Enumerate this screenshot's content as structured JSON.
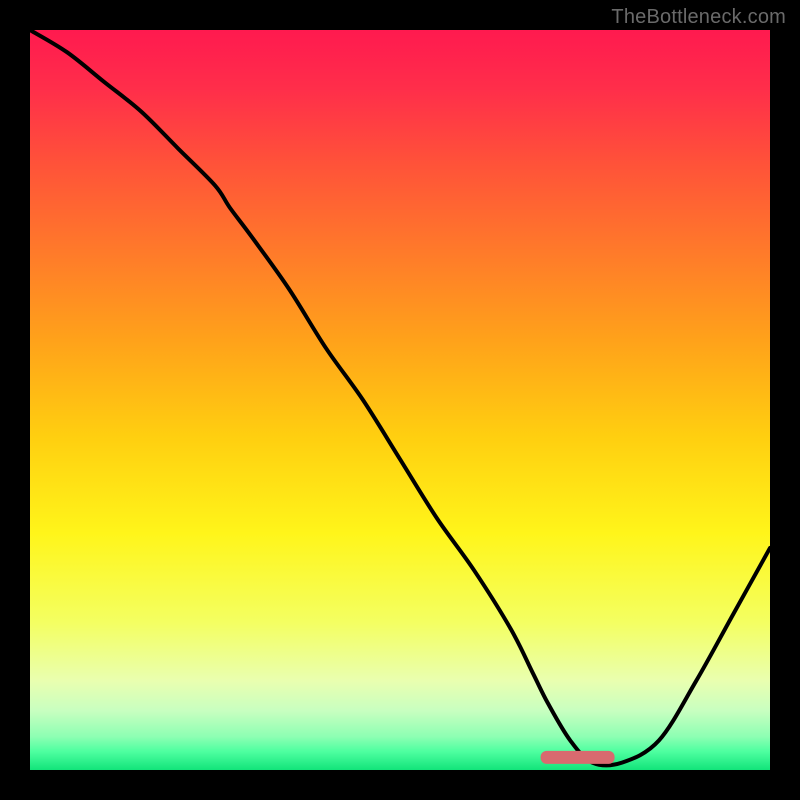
{
  "watermark": "TheBottleneck.com",
  "chart_data": {
    "type": "line",
    "title": "",
    "xlabel": "",
    "ylabel": "",
    "xlim": [
      0,
      100
    ],
    "ylim": [
      0,
      100
    ],
    "series": [
      {
        "name": "curve",
        "x": [
          0,
          5,
          10,
          15,
          20,
          25,
          27,
          30,
          35,
          40,
          45,
          50,
          55,
          60,
          65,
          68,
          70,
          73,
          76,
          80,
          85,
          90,
          95,
          100
        ],
        "values": [
          100,
          97,
          93,
          89,
          84,
          79,
          76,
          72,
          65,
          57,
          50,
          42,
          34,
          27,
          19,
          13,
          9,
          4,
          1,
          1,
          4,
          12,
          21,
          30
        ]
      }
    ],
    "marker": {
      "x_start": 69,
      "x_end": 79,
      "y": 1.7,
      "color": "#d86a6f"
    },
    "gradient_stops": [
      {
        "pos": 0.0,
        "color": "#ff1a4f"
      },
      {
        "pos": 0.08,
        "color": "#ff2e4a"
      },
      {
        "pos": 0.18,
        "color": "#ff5239"
      },
      {
        "pos": 0.3,
        "color": "#ff7a2a"
      },
      {
        "pos": 0.42,
        "color": "#ffa21a"
      },
      {
        "pos": 0.55,
        "color": "#ffcf10"
      },
      {
        "pos": 0.68,
        "color": "#fff51a"
      },
      {
        "pos": 0.8,
        "color": "#f4ff61"
      },
      {
        "pos": 0.88,
        "color": "#e9ffb0"
      },
      {
        "pos": 0.92,
        "color": "#c8ffc0"
      },
      {
        "pos": 0.955,
        "color": "#8dffb3"
      },
      {
        "pos": 0.975,
        "color": "#4effa0"
      },
      {
        "pos": 1.0,
        "color": "#12e47a"
      }
    ]
  }
}
